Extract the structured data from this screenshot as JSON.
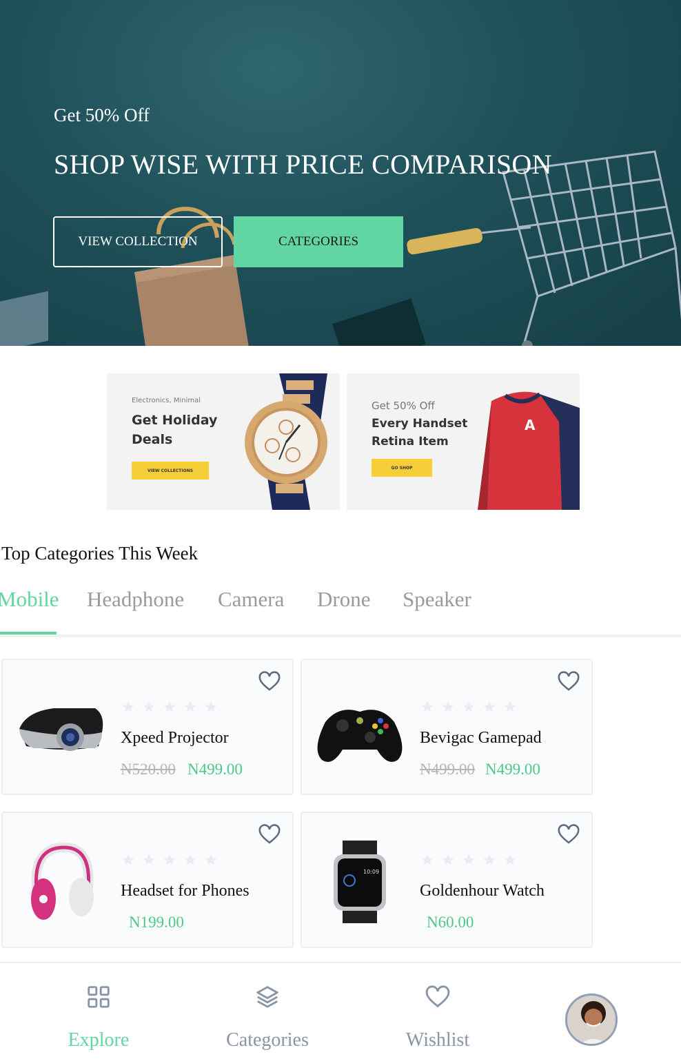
{
  "hero": {
    "eyebrow": "Get 50% Off",
    "title": "SHOP WISE WITH PRICE COMPARISON",
    "view_collection_label": "VIEW COLLECTION",
    "categories_label": "CATEGORIES"
  },
  "promos": [
    {
      "small": "Electronics, Minimal",
      "line1": "Get Holiday",
      "line2": "Deals",
      "chip": "VIEW COLLECTIONS"
    },
    {
      "small": "Get 50% Off",
      "line1": "Every Handset",
      "line2": "Retina Item",
      "chip": "GO SHOP"
    }
  ],
  "section": {
    "title": "Top Categories This Week"
  },
  "tabs": [
    "Mobile",
    "Headphone",
    "Camera",
    "Drone",
    "Speaker"
  ],
  "active_tab": "Mobile",
  "products": [
    {
      "name": "Xpeed Projector",
      "old_price": "N520.00",
      "price": "N499.00",
      "rating": 0,
      "icon": "projector-image"
    },
    {
      "name": "Bevigac Gamepad",
      "old_price": "N499.00",
      "price": "N499.00",
      "rating": 0,
      "icon": "gamepad-image"
    },
    {
      "name": "Headset for Phones",
      "old_price": "",
      "price": "N199.00",
      "rating": 0,
      "icon": "headphones-image"
    },
    {
      "name": "Goldenhour Watch",
      "old_price": "",
      "price": "N60.00",
      "rating": 0,
      "icon": "smartwatch-image"
    }
  ],
  "watch_time": "10:09",
  "bottom_nav": {
    "explore": "Explore",
    "categories": "Categories",
    "wishlist": "Wishlist",
    "active": "Explore"
  },
  "colors": {
    "accent": "#61d5a2",
    "price": "#4fc887",
    "hero_bg": "#1f5059",
    "promo_chip": "#f6cf38"
  }
}
